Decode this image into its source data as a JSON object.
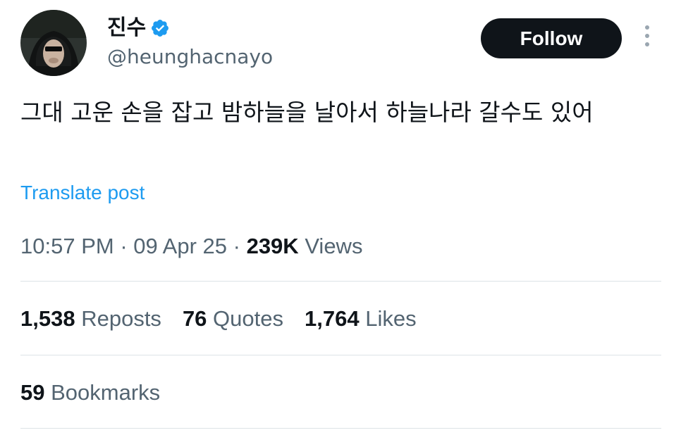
{
  "author": {
    "display_name": "진수",
    "handle": "@heunghacnayo",
    "verified": true,
    "verified_color": "#1d9bf0"
  },
  "actions": {
    "follow_label": "Follow"
  },
  "post": {
    "text": "그대 고운 손을 잡고 밤하늘을 날아서 하늘나라 갈수도 있어",
    "translate_label": "Translate post"
  },
  "meta": {
    "time": "10:57 PM",
    "separator": "·",
    "date": "09 Apr 25",
    "views_count": "239K",
    "views_label": "Views"
  },
  "stats": {
    "reposts_count": "1,538",
    "reposts_label": "Reposts",
    "quotes_count": "76",
    "quotes_label": "Quotes",
    "likes_count": "1,764",
    "likes_label": "Likes",
    "bookmarks_count": "59",
    "bookmarks_label": "Bookmarks"
  },
  "colors": {
    "text_primary": "#0f1419",
    "text_secondary": "#536471",
    "link": "#1d9bf0",
    "button_bg": "#0f1419",
    "divider": "#dde3e7"
  }
}
